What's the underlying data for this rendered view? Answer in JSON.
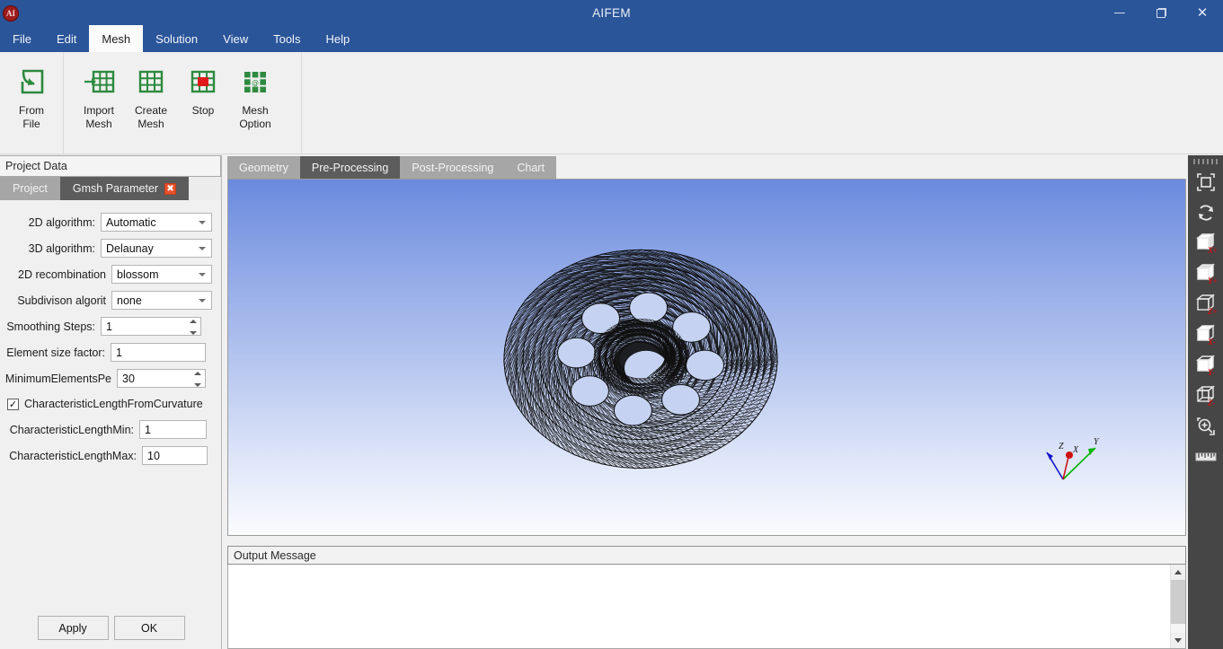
{
  "window": {
    "title": "AIFEM",
    "app_icon": "aifem-app-icon",
    "minimize": "minimize",
    "maximize": "restore",
    "close": "close"
  },
  "menubar": {
    "items": [
      {
        "label": "File",
        "active": false
      },
      {
        "label": "Edit",
        "active": false
      },
      {
        "label": "Mesh",
        "active": true
      },
      {
        "label": "Solution",
        "active": false
      },
      {
        "label": "View",
        "active": false
      },
      {
        "label": "Tools",
        "active": false
      },
      {
        "label": "Help",
        "active": false
      }
    ]
  },
  "ribbon": {
    "groups": [
      {
        "buttons": [
          {
            "label": "From\nFile",
            "icon": "import-arrow-into-box-icon"
          }
        ]
      },
      {
        "buttons": [
          {
            "label": "Import\nMesh",
            "icon": "import-mesh-grid-icon"
          },
          {
            "label": "Create\nMesh",
            "icon": "create-mesh-grid-icon"
          },
          {
            "label": "Stop",
            "icon": "stop-mesh-grid-icon"
          },
          {
            "label": "Mesh\nOption",
            "icon": "mesh-option-grid-icon"
          }
        ]
      }
    ],
    "colors": {
      "green": "#2d8a3e",
      "red": "#e01a1a"
    }
  },
  "left_panel": {
    "header": "Project Data",
    "tabs": [
      {
        "label": "Project",
        "active": false,
        "closable": false
      },
      {
        "label": "Gmsh Parameter",
        "active": true,
        "closable": true,
        "close_glyph": "✖"
      }
    ],
    "fields": [
      {
        "label": "2D algorithm:",
        "type": "combo",
        "value": "Automatic",
        "name": "2d-algorithm-combo"
      },
      {
        "label": "3D algorithm:",
        "type": "combo",
        "value": "Delaunay",
        "name": "3d-algorithm-combo"
      },
      {
        "label": "2D recombination",
        "type": "combo",
        "value": "blossom",
        "name": "2d-recombination-combo"
      },
      {
        "label": "Subdivison algorit",
        "type": "combo",
        "value": "none",
        "name": "subdivision-algorithm-combo"
      },
      {
        "label": "Smoothing Steps:",
        "type": "spin",
        "value": "1",
        "name": "smoothing-steps-spinner"
      },
      {
        "label": "Element size factor:",
        "type": "text",
        "value": "1",
        "name": "element-size-factor-input"
      },
      {
        "label": "MinimumElementsPe",
        "type": "spin",
        "value": "30",
        "name": "minimum-elements-per-spinner"
      }
    ],
    "checkbox": {
      "label": "CharacteristicLengthFromCurvature",
      "checked": true,
      "check_glyph": "✓"
    },
    "fields2": [
      {
        "label": "CharacteristicLengthMin:",
        "type": "text",
        "value": "1",
        "name": "characteristic-length-min-input"
      },
      {
        "label": "CharacteristicLengthMax:",
        "type": "text",
        "value": "10",
        "name": "characteristic-length-max-input"
      }
    ],
    "buttons": [
      {
        "label": "Apply",
        "name": "apply-button"
      },
      {
        "label": "OK",
        "name": "ok-button"
      }
    ]
  },
  "view_tabs": [
    {
      "label": "Geometry",
      "active": false
    },
    {
      "label": "Pre-Processing",
      "active": true
    },
    {
      "label": "Post-Processing",
      "active": false
    },
    {
      "label": "Chart",
      "active": false
    }
  ],
  "viewport": {
    "model": "meshed-wheel-hub-with-eight-bolt-holes",
    "background_top": "#6a8ade",
    "background_bottom": "#fbfcfe",
    "axes": {
      "x": {
        "label": "X",
        "color": "#cc1111"
      },
      "y": {
        "label": "Y",
        "color": "#00b400"
      },
      "z": {
        "label": "Z",
        "color": "#1414cc"
      }
    }
  },
  "view_toolbar": {
    "buttons": [
      {
        "name": "fit-to-window-button",
        "icon": "fit-frame-icon",
        "label": ""
      },
      {
        "name": "rotate-view-button",
        "icon": "rotate-refresh-icon",
        "label": ""
      },
      {
        "name": "view-x-plus-button",
        "icon": "cube-x-plus-icon",
        "label": "X+"
      },
      {
        "name": "view-y-plus-button",
        "icon": "cube-y-plus-icon",
        "label": "Y+"
      },
      {
        "name": "view-z-plus-button",
        "icon": "cube-z-plus-icon",
        "label": "Z+"
      },
      {
        "name": "view-x-minus-button",
        "icon": "cube-x-minus-icon",
        "label": "X-"
      },
      {
        "name": "view-y-minus-button",
        "icon": "cube-y-minus-icon",
        "label": "Y-"
      },
      {
        "name": "view-z-minus-button",
        "icon": "cube-z-minus-icon",
        "label": "Z-"
      },
      {
        "name": "zoom-in-button",
        "icon": "magnifier-plus-icon",
        "label": ""
      },
      {
        "name": "measure-button",
        "icon": "ruler-icon",
        "label": ""
      }
    ]
  },
  "output": {
    "header": "Output Message",
    "text": ""
  }
}
